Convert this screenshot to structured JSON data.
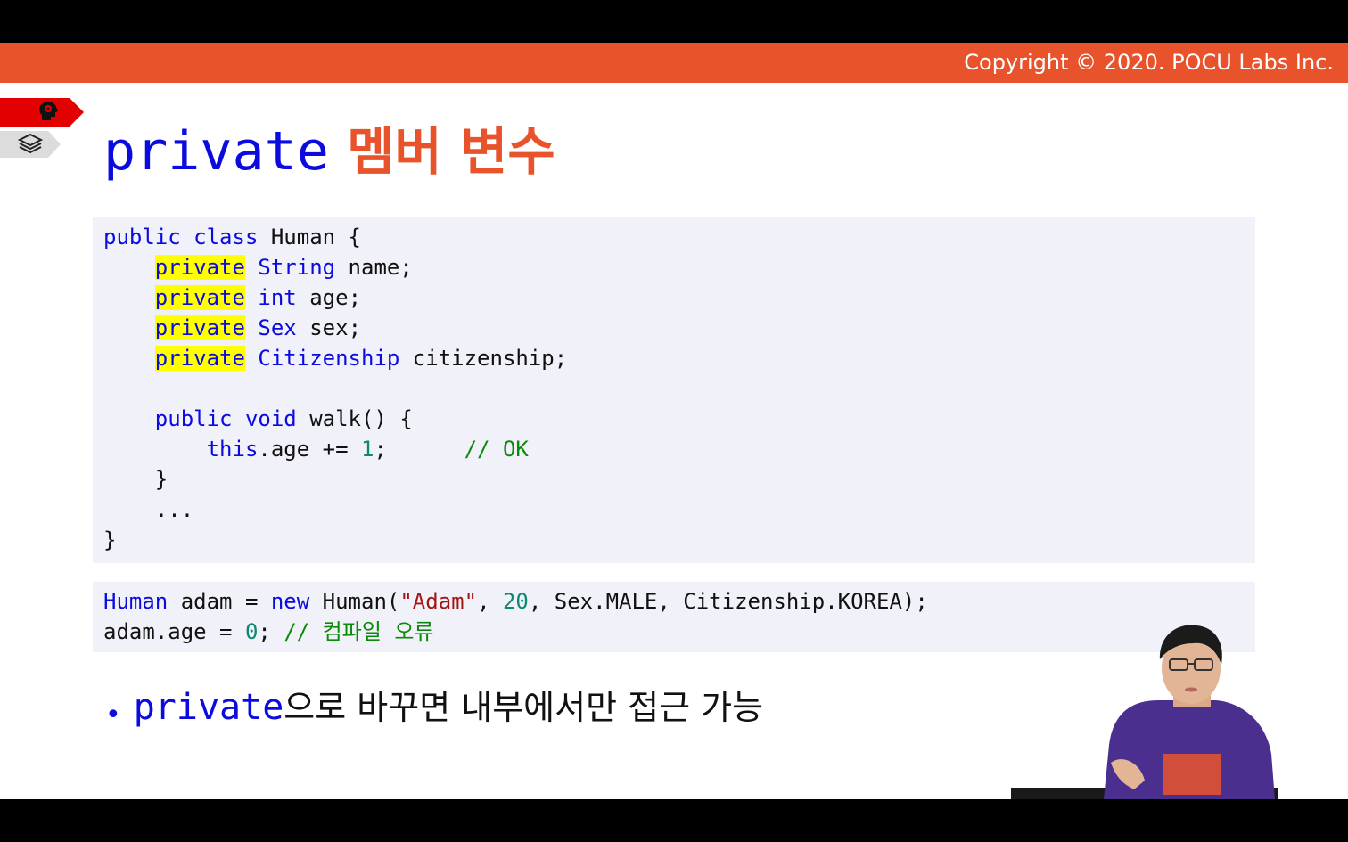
{
  "header": {
    "copyright": "Copyright © 2020. POCU Labs Inc."
  },
  "sidebar": {
    "icons": [
      "brain-head-icon",
      "layers-stack-icon"
    ]
  },
  "title": {
    "code": "private",
    "rest": " 멤버 변수"
  },
  "code_block_1": {
    "lines": [
      "public class Human {",
      "    private String name;",
      "    private int age;",
      "    private Sex sex;",
      "    private Citizenship citizenship;",
      "",
      "    public void walk() {",
      "        this.age += 1;      // OK",
      "    }",
      "    ...",
      "}"
    ]
  },
  "code_block_2": {
    "lines": [
      "Human adam = new Human(\"Adam\", 20, Sex.MALE, Citizenship.KOREA);",
      "adam.age = 0; // 컴파일 오류"
    ]
  },
  "bullet": {
    "code": "private",
    "text": "으로 바꾸면 내부에서만 접근 가능"
  },
  "colors": {
    "accent_orange": "#e8532b",
    "keyword_blue": "#0b0be0",
    "highlight_yellow": "#ffff00",
    "comment_green": "#0a8a0a",
    "string_red": "#a31515",
    "code_bg": "#f1f1f9"
  }
}
